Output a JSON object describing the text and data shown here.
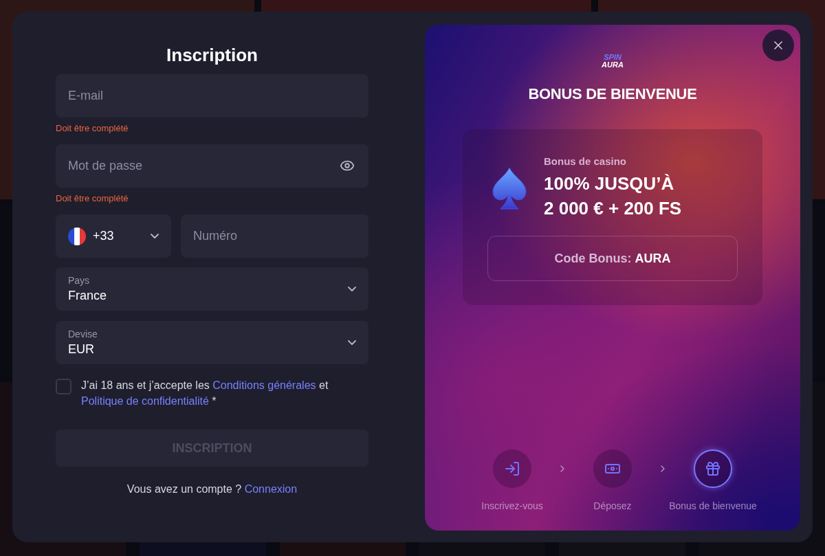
{
  "form": {
    "title": "Inscription",
    "email": {
      "placeholder": "E-mail",
      "error": "Doit être complété"
    },
    "password": {
      "placeholder": "Mot de passe",
      "error": "Doit être complété"
    },
    "phone": {
      "country_code": "+33",
      "placeholder": "Numéro"
    },
    "selects": [
      {
        "label": "Pays",
        "value": "France"
      },
      {
        "label": "Devise",
        "value": "EUR"
      }
    ],
    "consent": {
      "checked": false,
      "parts": [
        {
          "kind": "text",
          "text": "J’ai 18 ans et j’accepte les "
        },
        {
          "kind": "link",
          "text": "Conditions générales"
        },
        {
          "kind": "text",
          "text": " et "
        },
        {
          "kind": "link",
          "text": "Politique de confidentialité"
        },
        {
          "kind": "text",
          "text": " *"
        }
      ]
    },
    "submit": {
      "label": "INSCRIPTION",
      "disabled": true
    },
    "footer": {
      "text": "Vous avez un compte ?",
      "link": "Connexion"
    }
  },
  "promo": {
    "logo": [
      "SPIN",
      "AURA"
    ],
    "heading": "BONUS DE BIENVENUE",
    "card": {
      "label": "Bonus de casino",
      "headline": [
        "100% JUSQU’À",
        "2 000 € + 200 FS"
      ],
      "code_label": "Code Bonus:",
      "code": "AURA"
    },
    "steps": [
      {
        "kind": "signup",
        "label": "Inscrivez-vous",
        "selected": false
      },
      {
        "kind": "deposit",
        "label": "Déposez",
        "selected": false
      },
      {
        "kind": "gift",
        "label": "Bonus de bienvenue",
        "selected": true
      }
    ]
  }
}
